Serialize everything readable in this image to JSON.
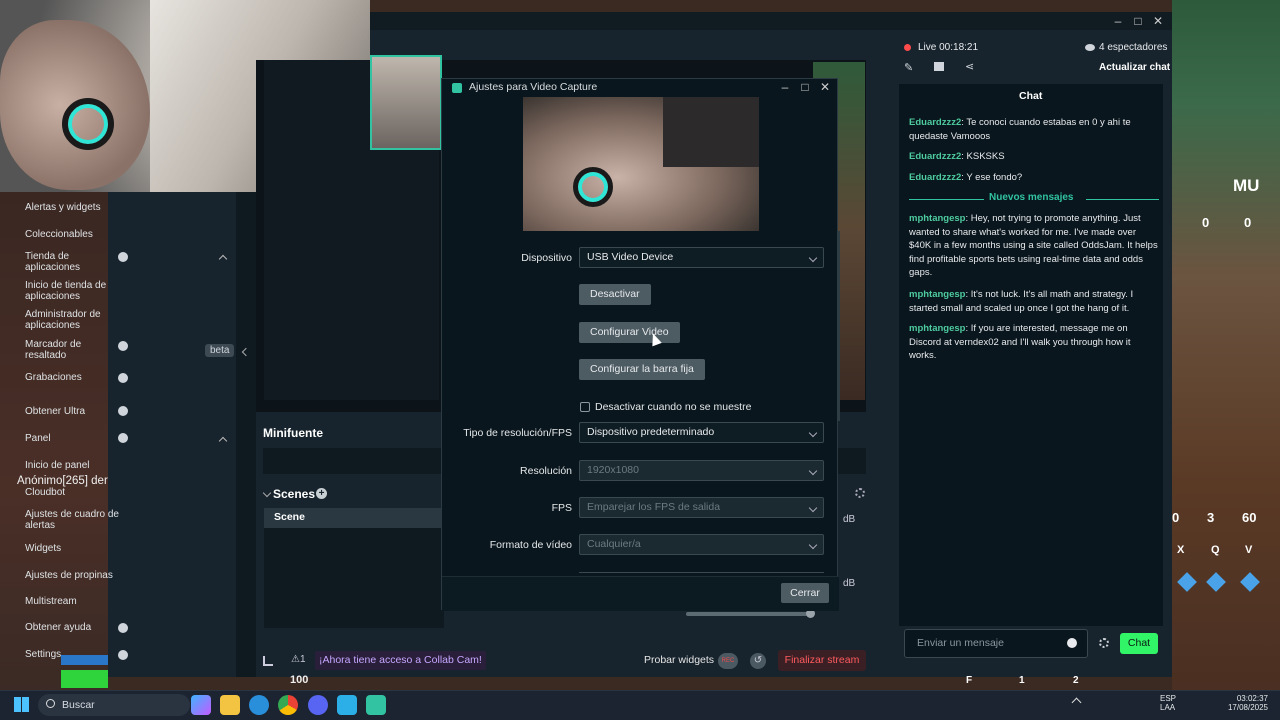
{
  "overlay": {
    "left_caption": "Anónimo[265] der",
    "left_bar_number": "100",
    "game_top_label": "MU",
    "game_counts": [
      "0",
      "0"
    ],
    "game_bottom_nums": [
      "0",
      "3",
      "60"
    ],
    "game_keys": [
      "X",
      "Q",
      "V"
    ],
    "game_bottom_row": [
      "F",
      "1",
      "2"
    ]
  },
  "window": {
    "min": "–",
    "max": "□",
    "close": "✕"
  },
  "sidebar": {
    "items": [
      {
        "label": "Alertas y widgets"
      },
      {
        "label": "Coleccionables"
      },
      {
        "label": "Tienda de aplicaciones"
      },
      {
        "label": "Inicio de tienda de aplicaciones"
      },
      {
        "label": "Administrador de aplicaciones"
      },
      {
        "label": "Marcador de resaltado"
      },
      {
        "label": "Grabaciones"
      },
      {
        "label": "Obtener Ultra"
      },
      {
        "label": "Panel"
      },
      {
        "label": "Inicio de panel"
      },
      {
        "label": "Cloudbot"
      },
      {
        "label": "Ajustes de cuadro de alertas"
      },
      {
        "label": "Widgets"
      },
      {
        "label": "Ajustes de propinas"
      },
      {
        "label": "Multistream"
      },
      {
        "label": "Obtener ayuda"
      },
      {
        "label": "Settings"
      }
    ],
    "beta_badge": "beta"
  },
  "editor": {
    "minifuente_title": "Minifuente",
    "scenes_title": "Scenes",
    "scene_item": "Scene",
    "db_label_1": "dB",
    "db_label_2": "dB"
  },
  "bottombar": {
    "collab_notice": "¡Ahora tiene acceso a Collab Cam!",
    "probar": "Probar widgets",
    "rec": "REC",
    "finalizar": "Finalizar stream"
  },
  "dialog": {
    "title": "Ajustes para Video Capture",
    "device_label": "Dispositivo",
    "device_value": "USB Video Device",
    "btn_desactivar": "Desactivar",
    "btn_configurar_video": "Configurar Video",
    "btn_configurar_barra": "Configurar la barra fija",
    "checkbox_label": "Desactivar cuando no se muestre",
    "res_type_label": "Tipo de resolución/FPS",
    "res_type_value": "Dispositivo predeterminado",
    "res_label": "Resolución",
    "res_value": "1920x1080",
    "fps_label": "FPS",
    "fps_value": "Emparejar los FPS de salida",
    "format_label": "Formato de vídeo",
    "format_value": "Cualquier/a",
    "close_btn": "Cerrar"
  },
  "chat": {
    "live": "Live 00:18:21",
    "viewers": "4 espectadores",
    "refresh": "Actualizar chat",
    "title": "Chat",
    "messages_old": [
      {
        "user": "Eduardzzz2",
        "text": ": Te conoci cuando estabas en 0 y ahi te quedaste Vamooos"
      },
      {
        "user": "Eduardzzz2",
        "text": ": KSKSKS"
      },
      {
        "user": "Eduardzzz2",
        "text": ": Y ese fondo?"
      }
    ],
    "new_messages": "Nuevos mensajes",
    "messages_new": [
      {
        "user": "mphtangesp",
        "text": ": Hey, not trying to promote anything. Just wanted to share what's worked for me. I've made over $40K in a few months using a site called OddsJam. It helps find profitable sports bets using real-time data and odds gaps."
      },
      {
        "user": "mphtangesp",
        "text": ": It's not luck. It's all math and strategy. I started small and scaled up once I got the hang of it."
      },
      {
        "user": "mphtangesp",
        "text": ": If you are interested, message me on Discord at verndex02 and I'll walk you through how it works."
      }
    ],
    "input_placeholder": "Enviar un mensaje",
    "send": "Chat"
  },
  "taskbar": {
    "search": "Buscar",
    "lang1": "ESP",
    "lang2": "LAA",
    "time": "03:02:37",
    "date": "17/08/2025"
  },
  "colors": {
    "accent": "#31c3a2",
    "username": "#4ecb9f",
    "danger": "#ff5a5f",
    "send": "#32f467"
  }
}
